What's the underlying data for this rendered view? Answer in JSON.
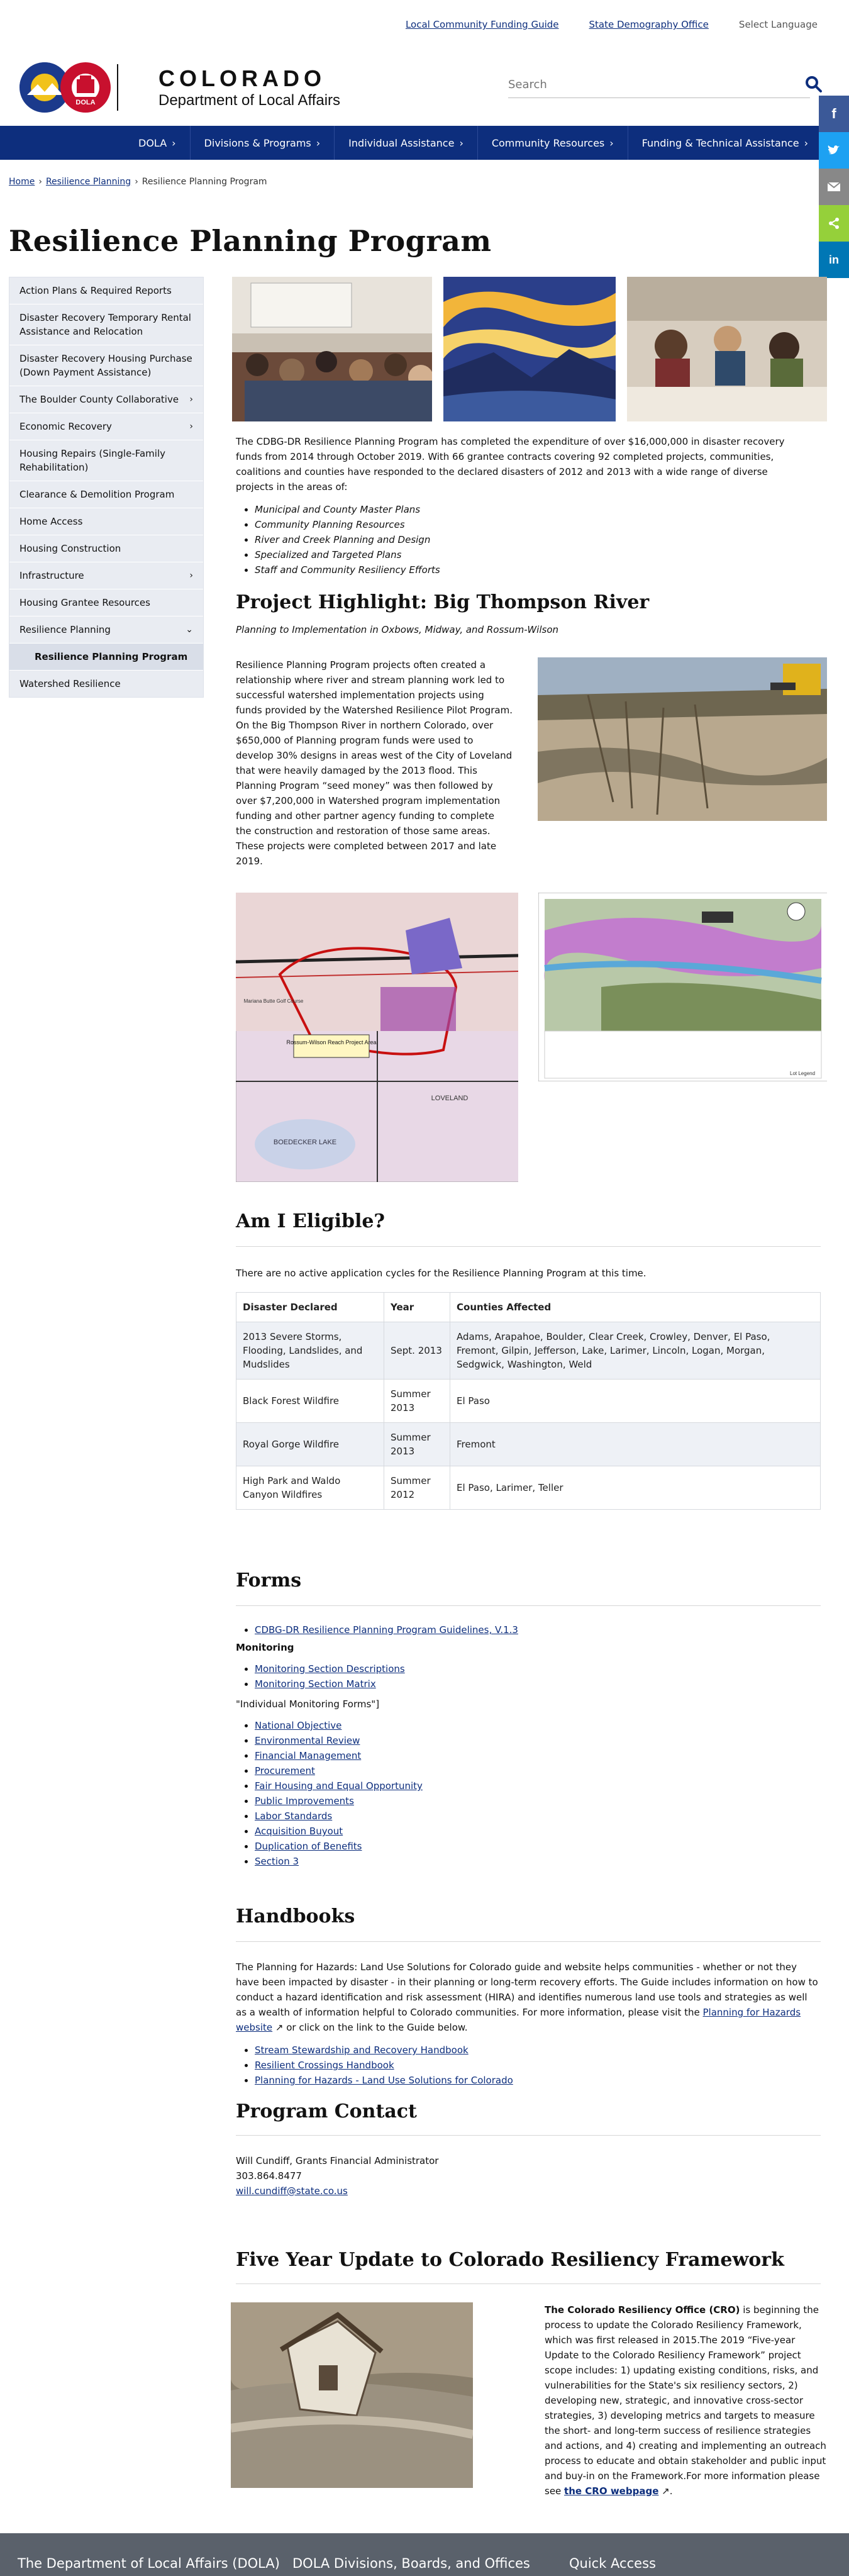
{
  "topbar": {
    "link1": "Local Community Funding Guide",
    "link2": "State Demography Office",
    "language": "Select Language"
  },
  "header": {
    "brand_line1": "COLORADO",
    "brand_line2": "Department of Local Affairs",
    "logo_badge": "DOLA",
    "search_placeholder": "Search"
  },
  "nav": [
    "DOLA",
    "Divisions & Programs",
    "Individual Assistance",
    "Community Resources",
    "Funding & Technical Assistance"
  ],
  "share_colors": {
    "facebook": "#3b5998",
    "twitter": "#1da1f2",
    "email": "#888888",
    "sharethis": "#95d03a",
    "linkedin": "#0077b5"
  },
  "breadcrumb": {
    "home": "Home",
    "parent": "Resilience Planning",
    "current": "Resilience Planning Program"
  },
  "page_title": "Resilience Planning Program",
  "sidebar": [
    {
      "label": "Action Plans & Required Reports",
      "chevron": false
    },
    {
      "label": "Disaster Recovery Temporary Rental Assistance and Relocation",
      "chevron": false
    },
    {
      "label": "Disaster Recovery Housing Purchase (Down Payment Assistance)",
      "chevron": false
    },
    {
      "label": "The Boulder County Collaborative",
      "chevron": true
    },
    {
      "label": "Economic Recovery",
      "chevron": true
    },
    {
      "label": "Housing Repairs (Single-Family Rehabilitation)",
      "chevron": false
    },
    {
      "label": "Clearance & Demolition Program",
      "chevron": false
    },
    {
      "label": "Home Access",
      "chevron": false
    },
    {
      "label": "Housing Construction",
      "chevron": false
    },
    {
      "label": "Infrastructure",
      "chevron": true
    },
    {
      "label": "Housing Grantee Resources",
      "chevron": false
    },
    {
      "label": "Resilience Planning",
      "chevron": true
    },
    {
      "label": "Resilience Planning Program",
      "chevron": false,
      "sub": true
    },
    {
      "label": "Watershed Resilience",
      "chevron": false
    }
  ],
  "intro": "The CDBG-DR Resilience Planning Program has completed the expenditure of over $16,000,000 in disaster recovery funds from 2014 through October 2019. With 66 grantee contracts covering 92 completed projects, communities, coalitions and counties have responded to the declared disasters of 2012 and 2013 with a wide range of diverse projects in the areas of:",
  "focus_areas": [
    "Municipal and County Master Plans",
    "Community Planning Resources",
    "River and Creek Planning and Design",
    "Specialized and Targeted Plans",
    "Staff and Community Resiliency Efforts"
  ],
  "highlight": {
    "title": "Project Highlight: Big Thompson River",
    "subtitle": "Planning to Implementation in Oxbows, Midway, and Rossum-Wilson",
    "body": "Resilience Planning Program projects often created a relationship where river and stream planning work led to successful watershed implementation projects using funds provided by the Watershed Resilience Pilot Program. On the Big Thompson River in northern Colorado, over $650,000 of Planning program funds were used to develop 30% designs in areas west of the City of Loveland that were heavily damaged by the 2013 flood. This Planning Program “seed money” was then followed by over $7,200,000 in Watershed program implementation funding and other partner agency funding to complete the construction and restoration of those same areas. These projects were completed between 2017 and late 2019."
  },
  "map_labels": {
    "area1": "Rossum-Wilson Reach Project Area",
    "lake": "BOEDECKER LAKE",
    "town": "LOVELAND",
    "golf": "Mariana Butte Golf Course",
    "legend": "Lot Legend"
  },
  "eligible": {
    "title": "Am I Eligible?",
    "note": "There are no active application cycles for the Resilience Planning Program at this time.",
    "headers": [
      "Disaster Declared",
      "Year",
      "Counties Affected"
    ],
    "rows": [
      [
        "2013 Severe Storms, Flooding, Landslides, and Mudslides",
        "Sept. 2013",
        "Adams, Arapahoe, Boulder, Clear Creek, Crowley, Denver, El Paso, Fremont, Gilpin, Jefferson, Lake, Larimer, Lincoln, Logan, Morgan, Sedgwick, Washington, Weld"
      ],
      [
        "Black Forest Wildfire",
        "Summer 2013",
        "El Paso"
      ],
      [
        "Royal Gorge Wildfire",
        "Summer 2013",
        "Fremont"
      ],
      [
        "High Park and Waldo Canyon Wildfires",
        "Summer 2012",
        "El Paso, Larimer, Teller"
      ]
    ]
  },
  "forms": {
    "title": "Forms",
    "guidelines": "CDBG-DR Resilience Planning Program Guidelines, V.1.3",
    "monitoring_label": "Monitoring",
    "monitoring": [
      "Monitoring Section Descriptions",
      "Monitoring Section Matrix"
    ],
    "individual_label": "\"Individual Monitoring Forms\"]",
    "individual": [
      "National Objective",
      "Environmental Review",
      "Financial Management",
      "Procurement",
      "Fair Housing and Equal Opportunity",
      "Public Improvements",
      "Labor Standards",
      "Acquisition Buyout",
      "Duplication of Benefits",
      "Section 3"
    ]
  },
  "handbooks": {
    "title": "Handbooks",
    "body": "The Planning for Hazards: Land Use Solutions for Colorado guide and website helps communities - whether or not they have been impacted by disaster - in their planning or long-term recovery efforts. The Guide includes information on how to conduct a hazard identification and risk assessment (HIRA) and identifies numerous land use tools and strategies as well as a wealth of information helpful to Colorado communities. For more information, please visit the",
    "link": "Planning for Hazards website",
    "tail": " or click on the link to the Guide below.",
    "items": [
      "Stream Stewardship and Recovery Handbook",
      "Resilient Crossings Handbook",
      "Planning for Hazards - Land Use Solutions for Colorado"
    ]
  },
  "contact": {
    "title": "Program Contact",
    "name": "Will Cundiff, Grants Financial Administrator",
    "phone": "303.864.8477",
    "email": "will.cundiff@state.co.us"
  },
  "fiveyear": {
    "title": "Five Year Update to Colorado Resiliency Framework",
    "lead": "The Colorado Resiliency Office (CRO)",
    "body": " is beginning the process to update the Colorado Resiliency Framework, which was first released in 2015.The 2019 “Five-year Update to the Colorado Resiliency Framework” project scope includes: 1) updating existing conditions, risks, and vulnerabilities for the State's six resiliency sectors, 2) developing new, strategic, and innovative cross-sector strategies, 3) developing metrics and targets to measure the short- and long-term success of resilience strategies and actions, and 4) creating and implementing an outreach process to educate and obtain stakeholder and public input and buy-in on the Framework.For more information please see ",
    "link": "the CRO webpage"
  },
  "footer": [
    "The Department of Local Affairs (DOLA)",
    "DOLA Divisions, Boards, and Offices",
    "Quick Access"
  ]
}
